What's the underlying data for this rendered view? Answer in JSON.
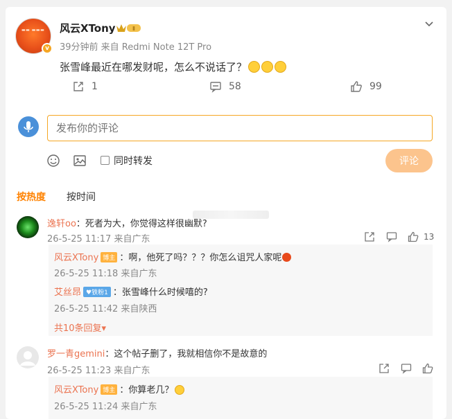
{
  "post": {
    "author": "风云XTony",
    "meta": "39分钟前 来自 Redmi Note 12T Pro",
    "text": "张雪峰最近在哪发财呢，怎么不说话了？",
    "vip_level": "Ⅱ",
    "verified_mark": "v",
    "shares": "1",
    "comments": "58",
    "likes": "99"
  },
  "composer": {
    "placeholder": "发布你的评论",
    "repost_label": "同时转发",
    "submit_label": "评论"
  },
  "sort": {
    "hot": "按热度",
    "time": "按时间"
  },
  "comments": [
    {
      "user": "逸轩oo",
      "text": "：死者为大，你觉得这样很幽默?",
      "time": "26-5-25 11:17 来自广东",
      "likes": "13",
      "replies": [
        {
          "user": "风云XTony",
          "badge": "博主",
          "text": "：啊，他死了吗？？？你怎么诅咒人家呢",
          "time": "26-5-25 11:18 来自广东"
        },
        {
          "user": "艾丝昂",
          "badge": "铁粉1",
          "text": "：张雪峰什么时候嘻的?",
          "time": "26-5-25 11:42 来自陕西"
        }
      ],
      "more": "共10条回复"
    },
    {
      "user": "罗一青gemini",
      "text": "：这个帖子删了，我就相信你不是故意的",
      "time": "26-5-25 11:23 来自广东",
      "replies": [
        {
          "user": "风云XTony",
          "badge": "博主",
          "text": "：你算老几？",
          "time": "26-5-25 11:24 来自广东"
        }
      ]
    }
  ],
  "colors": {
    "accent": "#ff8200",
    "username": "#eb7350",
    "submit": "#fcc48d",
    "input_border": "#f5a623"
  }
}
